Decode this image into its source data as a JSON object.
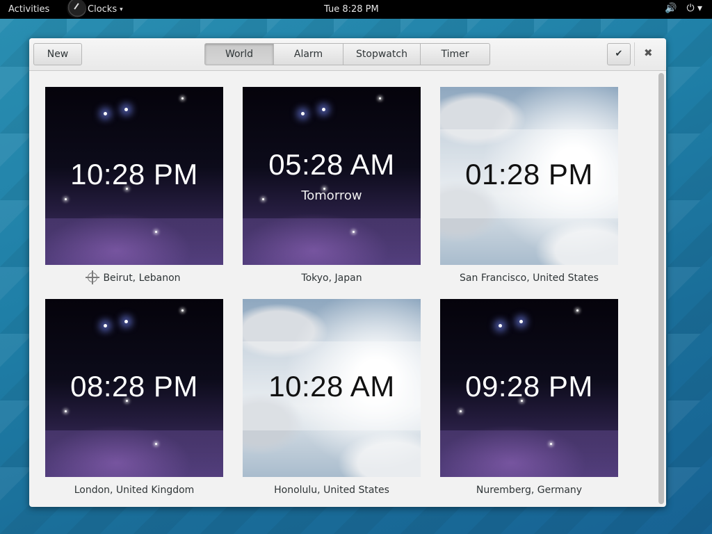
{
  "topbar": {
    "activities": "Activities",
    "app_title": "Clocks",
    "clock": "Tue  8:28 PM",
    "icons": [
      "volume-icon",
      "power-icon"
    ]
  },
  "header": {
    "new_label": "New",
    "tabs": [
      {
        "label": "World"
      },
      {
        "label": "Alarm"
      },
      {
        "label": "Stopwatch"
      },
      {
        "label": "Timer"
      }
    ],
    "check_glyph": "✔",
    "close_glyph": "✖"
  },
  "clocks": [
    {
      "time": "10:28 PM",
      "day": "",
      "city": "Beirut, Lebanon",
      "theme": "night",
      "current_location": true
    },
    {
      "time": "05:28 AM",
      "day": "Tomorrow",
      "city": "Tokyo, Japan",
      "theme": "night",
      "current_location": false
    },
    {
      "time": "01:28 PM",
      "day": "",
      "city": "San Francisco, United States",
      "theme": "day",
      "current_location": false
    },
    {
      "time": "08:28 PM",
      "day": "",
      "city": "London, United Kingdom",
      "theme": "night",
      "current_location": false
    },
    {
      "time": "10:28 AM",
      "day": "",
      "city": "Honolulu, United States",
      "theme": "day",
      "current_location": false
    },
    {
      "time": "09:28 PM",
      "day": "",
      "city": "Nuremberg, Germany",
      "theme": "night",
      "current_location": false
    }
  ],
  "colors": {
    "topbar_bg": "#000000",
    "night_accent": "#4d3a76",
    "desktop_bg": "#1f7fa7"
  }
}
